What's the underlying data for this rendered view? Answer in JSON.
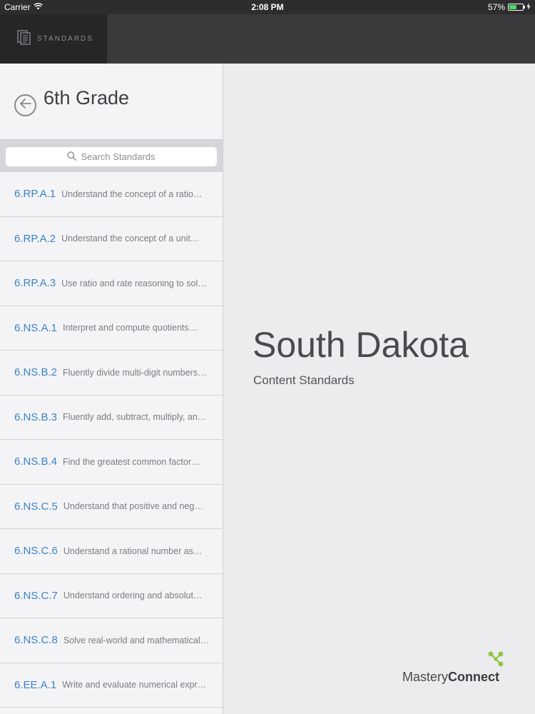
{
  "status_bar": {
    "carrier": "Carrier",
    "time": "2:08 PM",
    "battery": "57%",
    "battery_level": 0.57
  },
  "top_nav": {
    "tab_label": "STANDARDS"
  },
  "sidebar": {
    "title": "6th Grade",
    "search_placeholder": "Search Standards",
    "items": [
      {
        "code": "6.RP.A.1",
        "desc": "Understand the concept of a ratio…"
      },
      {
        "code": "6.RP.A.2",
        "desc": "Understand the concept of a unit…"
      },
      {
        "code": "6.RP.A.3",
        "desc": "Use ratio and rate reasoning to sol…"
      },
      {
        "code": "6.NS.A.1",
        "desc": "Interpret and compute quotients…"
      },
      {
        "code": "6.NS.B.2",
        "desc": "Fluently divide multi-digit numbers…"
      },
      {
        "code": "6.NS.B.3",
        "desc": "Fluently add, subtract, multiply, an…"
      },
      {
        "code": "6.NS.B.4",
        "desc": "Find the greatest common factor…"
      },
      {
        "code": "6.NS.C.5",
        "desc": "Understand that positive and neg…"
      },
      {
        "code": "6.NS.C.6",
        "desc": "Understand a rational number as…"
      },
      {
        "code": "6.NS.C.7",
        "desc": "Understand ordering and absolut…"
      },
      {
        "code": "6.NS.C.8",
        "desc": "Solve real-world and mathematical…"
      },
      {
        "code": "6.EE.A.1",
        "desc": "Write and evaluate numerical expr…"
      }
    ]
  },
  "main": {
    "state": "South Dakota",
    "subtitle": "Content Standards",
    "logo_light": "Mastery",
    "logo_bold": "Connect"
  },
  "colors": {
    "accent": "#3a83c8",
    "logo_green": "#8dc63f",
    "battery_green": "#4cd964"
  }
}
